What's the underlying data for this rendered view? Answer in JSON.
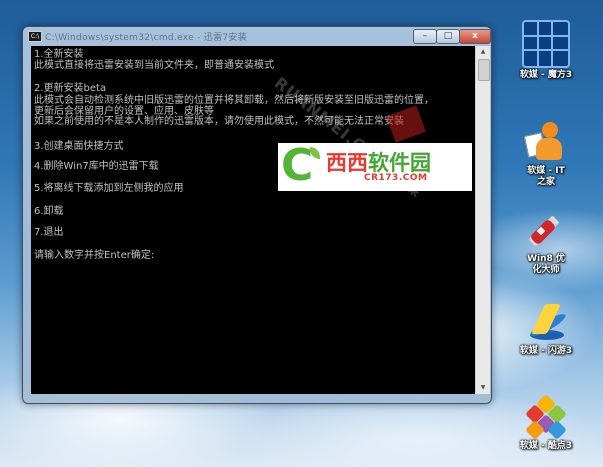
{
  "window": {
    "title": "C:\\Windows\\system32\\cmd.exe - 迅雷7安装",
    "icon_text": "C:\\",
    "controls": {
      "minimize": "–",
      "maximize": "□",
      "close": "x"
    }
  },
  "console": {
    "lines": [
      "1.全新安装",
      "此模式直接将迅雷安装到当前文件夹，即普通安装模式",
      "",
      "2.更新安装beta",
      "此模式会自动检测系统中旧版迅雷的位置并将其卸载，然后将新版安装至旧版迅雷的位置，",
      "更新后会保留用户的设置、应用、皮肤等",
      "如果之前使用的不是本人制作的迅雷版本，请勿使用此模式，不然可能无法正常安装",
      "",
      "3.创建桌面快捷方式",
      "",
      "4.删除Win7库中的迅雷下载",
      "",
      "5.将离线下载添加到左侧我的应用",
      "",
      "6.卸载",
      "",
      "7.退出",
      "",
      "请输入数字并按Enter确定:"
    ]
  },
  "watermark": {
    "text": "RUANMEI.COM 软媒"
  },
  "logo": {
    "letter": "C",
    "main_red": "西西",
    "main_green": "软件园",
    "sub": "CR173.COM"
  },
  "desktop_icons": [
    {
      "label": "软媒 - 魔方3",
      "icon": "rubik-cube-icon"
    },
    {
      "label": "软媒 - IT之家",
      "icon": "ithome-person-icon"
    },
    {
      "label": "Win8 优化大师",
      "icon": "swiss-knife-icon"
    },
    {
      "label": "软媒 - 闪游3",
      "icon": "flash-game-icon"
    },
    {
      "label": "软媒 - 酷点3",
      "icon": "colorful-hexagons-icon"
    }
  ]
}
